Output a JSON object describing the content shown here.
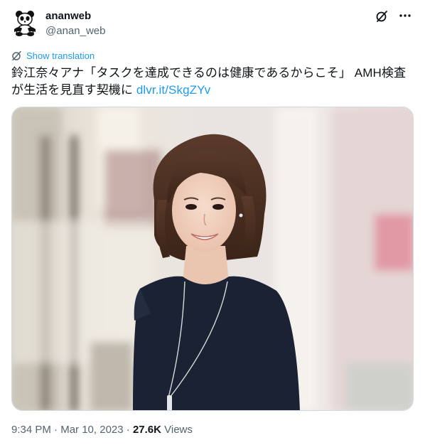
{
  "author": {
    "display_name": "ananweb",
    "handle": "@anan_web",
    "avatar_icon": "panda-logo-icon"
  },
  "header_actions": {
    "grok_icon": "grok-slash-icon",
    "more_icon": "more-dots-icon"
  },
  "translation": {
    "label": "Show translation",
    "icon": "translate-icon"
  },
  "tweet": {
    "line1": "鈴江奈々アナ「タスクを達成できるのは健康であるからこそ」 AMH検査",
    "line2_text": "が生活を見直す契機に ",
    "link_text": "dlvr.it/SkgZYv"
  },
  "media": {
    "type": "photo"
  },
  "meta": {
    "time": "9:34 PM",
    "separator1": " · ",
    "date": "Mar 10, 2023",
    "separator2": " · ",
    "views_count": "27.6K",
    "views_label": " Views"
  },
  "colors": {
    "accent": "#1d9bf0",
    "text": "#0f1419",
    "secondary": "#536471",
    "border": "#cfd9de"
  }
}
